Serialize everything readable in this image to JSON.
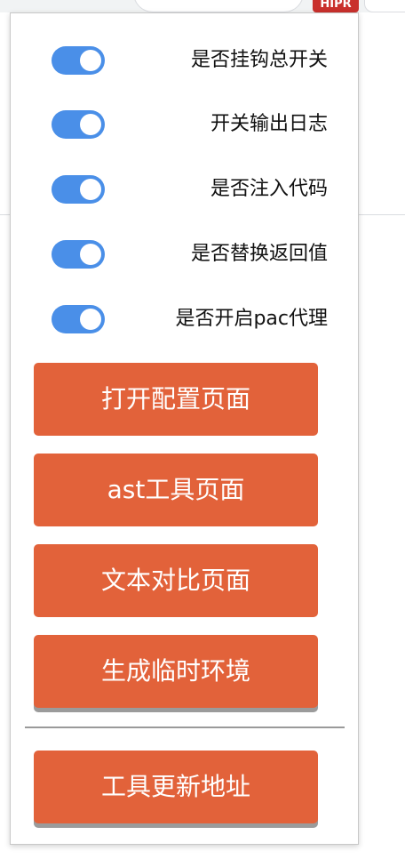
{
  "extension": {
    "badge_text": "HIPR"
  },
  "toggles": [
    {
      "label": "是否挂钩总开关",
      "on": true
    },
    {
      "label": "开关输出日志",
      "on": true
    },
    {
      "label": "是否注入代码",
      "on": true
    },
    {
      "label": "是否替换返回值",
      "on": true
    },
    {
      "label": "是否开启pac代理",
      "on": true
    }
  ],
  "buttons": {
    "open_config": "打开配置页面",
    "ast_tool": "ast工具页面",
    "text_diff": "文本对比页面",
    "temp_env": "生成临时环境",
    "update_url": "工具更新地址"
  },
  "colors": {
    "toggle_on": "#4a8fe8",
    "button_bg": "#e2623a",
    "badge_bg": "#c9302c"
  }
}
